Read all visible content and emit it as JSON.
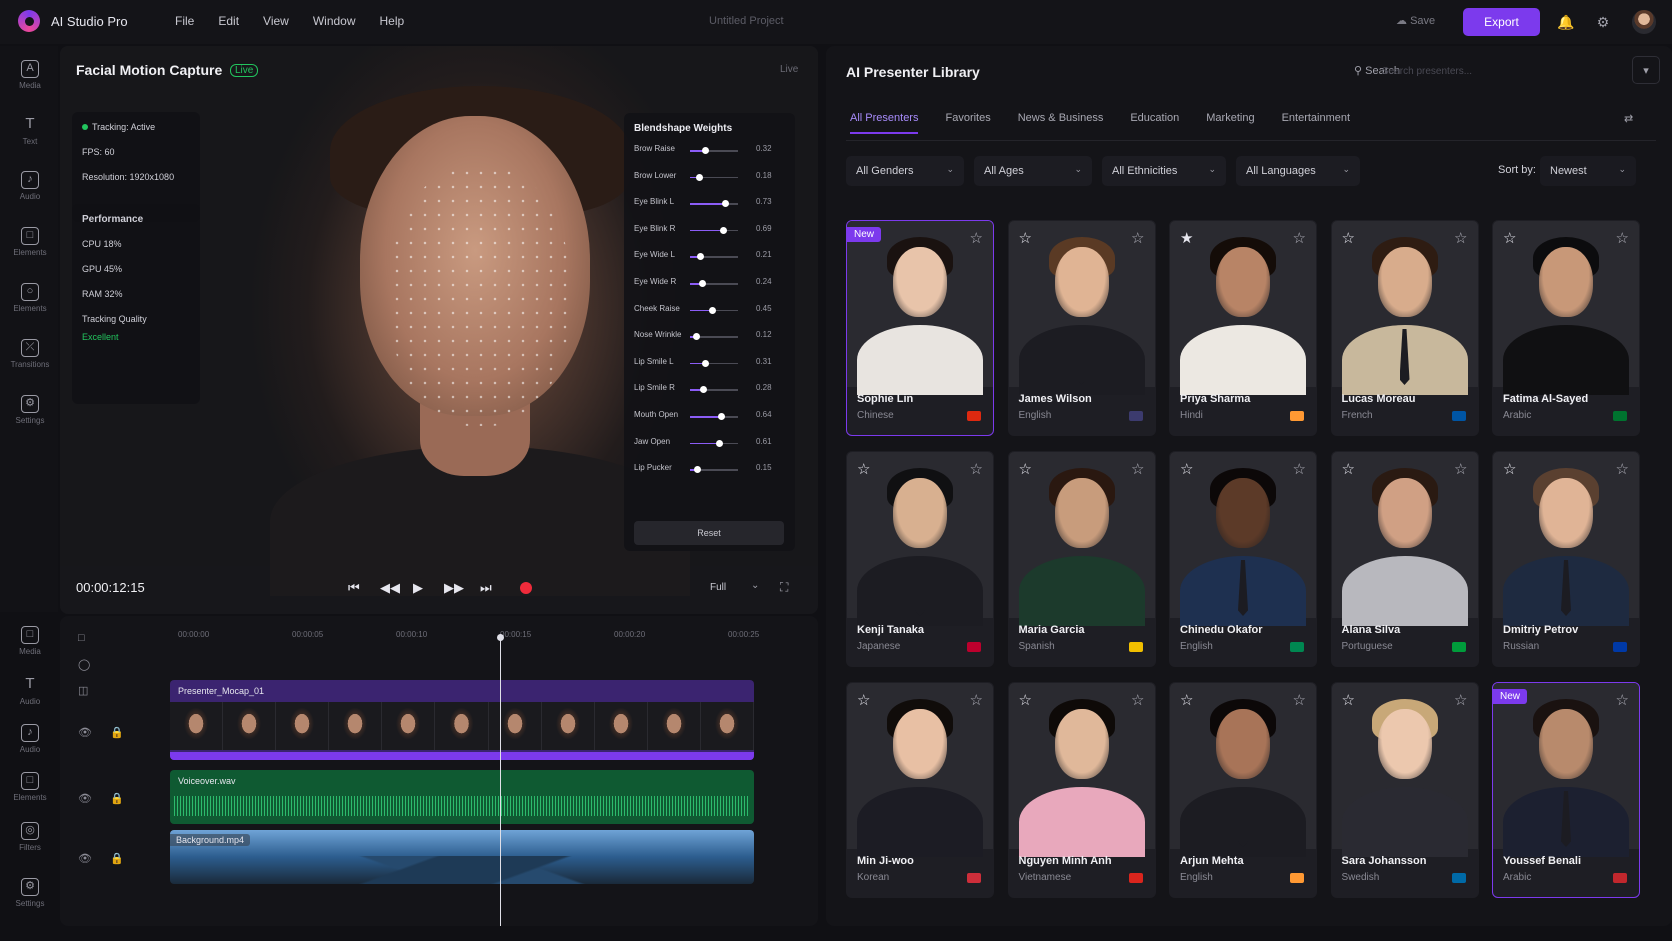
{
  "app": {
    "name": "AI Studio Pro",
    "project": "Untitled Project",
    "save": "Save",
    "export": "Export"
  },
  "menu": [
    "File",
    "Edit",
    "View",
    "Window",
    "Help"
  ],
  "rail_top": [
    "Media",
    "Text",
    "Audio",
    "Elements",
    "Elements",
    "Transitions",
    "Settings"
  ],
  "rail_bottom": [
    "Media",
    "Audio",
    "Audio",
    "Elements",
    "Filters",
    "Settings"
  ],
  "preview": {
    "title": "Facial Motion Capture",
    "live": "Live",
    "corner": "Live",
    "tracking": "Tracking: Active",
    "fps": "FPS: 60",
    "resolution": "Resolution: 1920x1080",
    "perf_title": "Performance",
    "cpu": "CPU  18%",
    "gpu": "GPU  45%",
    "ram": "RAM  32%",
    "quality_label": "Tracking Quality",
    "quality_value": "Excellent",
    "timecode": "00:00:12:15",
    "view_mode": "Full"
  },
  "blendshapes": {
    "title": "Blendshape Weights",
    "reset": "Reset",
    "items": [
      {
        "label": "Brow Raise",
        "value": "0.32",
        "v": 0.32
      },
      {
        "label": "Brow Lower",
        "value": "0.18",
        "v": 0.18
      },
      {
        "label": "Eye Blink L",
        "value": "0.73",
        "v": 0.73
      },
      {
        "label": "Eye Blink R",
        "value": "0.69",
        "v": 0.69
      },
      {
        "label": "Eye Wide L",
        "value": "0.21",
        "v": 0.21
      },
      {
        "label": "Eye Wide R",
        "value": "0.24",
        "v": 0.24
      },
      {
        "label": "Cheek Raise",
        "value": "0.45",
        "v": 0.45
      },
      {
        "label": "Nose Wrinkle",
        "value": "0.12",
        "v": 0.12
      },
      {
        "label": "Lip Smile L",
        "value": "0.31",
        "v": 0.31
      },
      {
        "label": "Lip Smile R",
        "value": "0.28",
        "v": 0.28
      },
      {
        "label": "Mouth Open",
        "value": "0.64",
        "v": 0.64
      },
      {
        "label": "Jaw Open",
        "value": "0.61",
        "v": 0.61
      },
      {
        "label": "Lip Pucker",
        "value": "0.15",
        "v": 0.15
      }
    ]
  },
  "timeline": {
    "ticks": [
      "00:00:00",
      "00:00:05",
      "00:00:10",
      "00:00:15",
      "00:00:20",
      "00:00:25"
    ],
    "tracks": [
      "Presenter_Mocap_01",
      "Voiceover.wav",
      "Background.mp4"
    ]
  },
  "library": {
    "title": "AI Presenter Library",
    "search_label": "Search",
    "search_placeholder": "Search presenters...",
    "tabs": [
      "All Presenters",
      "Favorites",
      "News & Business",
      "Education",
      "Marketing",
      "Entertainment"
    ],
    "filters": [
      "All Genders",
      "All Ages",
      "All Ethnicities",
      "All Languages"
    ],
    "sort_label": "Sort by:",
    "sort_value": "Newest",
    "new_badge": "New",
    "presenters": [
      {
        "name": "Sophie Lin",
        "lang": "Chinese",
        "flag": "#de2910",
        "skin": "#e8c4aa",
        "hair": "#1a1210",
        "outfit": "#e8e4e0",
        "tie": false,
        "isnew": true,
        "fav": false
      },
      {
        "name": "James Wilson",
        "lang": "English",
        "flag": "#3c3b6e",
        "skin": "#e0b494",
        "hair": "#5a3a24",
        "outfit": "#1c1c22",
        "tie": true,
        "isnew": false,
        "fav": false
      },
      {
        "name": "Priya Sharma",
        "lang": "Hindi",
        "flag": "#ff9933",
        "skin": "#b88466",
        "hair": "#140c08",
        "outfit": "#ece8e2",
        "tie": false,
        "isnew": false,
        "fav": true
      },
      {
        "name": "Lucas Moreau",
        "lang": "French",
        "flag": "#0055a4",
        "skin": "#d8ac8c",
        "hair": "#2e1c12",
        "outfit": "#c8b89c",
        "tie": true,
        "isnew": false,
        "fav": false
      },
      {
        "name": "Fatima Al-Sayed",
        "lang": "Arabic",
        "flag": "#00732f",
        "skin": "#c89878",
        "hair": "#0c0c0e",
        "outfit": "#101012",
        "tie": false,
        "isnew": false,
        "fav": false
      },
      {
        "name": "Kenji Tanaka",
        "lang": "Japanese",
        "flag": "#bc002d",
        "skin": "#d8b090",
        "hair": "#101012",
        "outfit": "#1c1c22",
        "tie": true,
        "isnew": false,
        "fav": false
      },
      {
        "name": "Maria Garcia",
        "lang": "Spanish",
        "flag": "#f1bf00",
        "skin": "#c89c7c",
        "hair": "#2a1810",
        "outfit": "#1c3a2c",
        "tie": false,
        "isnew": false,
        "fav": false
      },
      {
        "name": "Chinedu Okafor",
        "lang": "English",
        "flag": "#008751",
        "skin": "#5c3a28",
        "hair": "#0c0808",
        "outfit": "#1e3050",
        "tie": true,
        "isnew": false,
        "fav": false
      },
      {
        "name": "Alana Silva",
        "lang": "Portuguese",
        "flag": "#009c3b",
        "skin": "#d0a084",
        "hair": "#2a1a12",
        "outfit": "#b8b8be",
        "tie": false,
        "isnew": false,
        "fav": false
      },
      {
        "name": "Dmitriy Petrov",
        "lang": "Russian",
        "flag": "#0039a6",
        "skin": "#e0b496",
        "hair": "#5a4030",
        "outfit": "#1e2a40",
        "tie": true,
        "isnew": false,
        "fav": false
      },
      {
        "name": "Min Ji-woo",
        "lang": "Korean",
        "flag": "#cd2e3a",
        "skin": "#e8c0a4",
        "hair": "#100c0a",
        "outfit": "#1c1c24",
        "tie": false,
        "isnew": false,
        "fav": false
      },
      {
        "name": "Nguyen Minh Anh",
        "lang": "Vietnamese",
        "flag": "#da251d",
        "skin": "#e0b89a",
        "hair": "#0e0a08",
        "outfit": "#e8a8bc",
        "tie": false,
        "isnew": false,
        "fav": false
      },
      {
        "name": "Arjun Mehta",
        "lang": "English",
        "flag": "#ff9933",
        "skin": "#a87458",
        "hair": "#0c0808",
        "outfit": "#1c1c22",
        "tie": true,
        "isnew": false,
        "fav": false
      },
      {
        "name": "Sara Johansson",
        "lang": "Swedish",
        "flag": "#006aa7",
        "skin": "#ecc8ae",
        "hair": "#c8a878",
        "outfit": "#2a2a32",
        "tie": false,
        "isnew": false,
        "fav": false
      },
      {
        "name": "Youssef Benali",
        "lang": "Arabic",
        "flag": "#c1272d",
        "skin": "#b88a6c",
        "hair": "#1a1210",
        "outfit": "#1c2030",
        "tie": true,
        "isnew": true,
        "fav": false
      }
    ]
  }
}
